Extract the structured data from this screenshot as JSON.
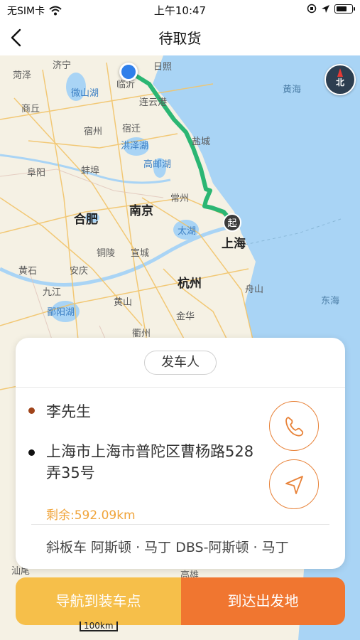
{
  "status_bar": {
    "carrier": "无SIM卡",
    "time": "上午10:47"
  },
  "nav": {
    "title": "待取货"
  },
  "map": {
    "labels": {
      "heze": "菏泽",
      "jining": "济宁",
      "rizhao": "日照",
      "weishan_lake": "微山湖",
      "linyi": "临沂",
      "lianyungang": "连云港",
      "shangqiu": "商丘",
      "suzhou_ah": "宿州",
      "suqian": "宿迁",
      "hongze_lake": "洪泽湖",
      "yancheng": "盐城",
      "gaoyou_lake": "高邮湖",
      "fuyang": "阜阳",
      "bengbu": "蚌埠",
      "changzhou": "常州",
      "nanjing": "南京",
      "hefei": "合肥",
      "taihu": "太湖",
      "shanghai": "上海",
      "tongling": "铜陵",
      "xuancheng": "宣城",
      "anqing": "安庆",
      "huangshi": "黄石",
      "hangzhou": "杭州",
      "jiujiang": "九江",
      "zhoushan": "舟山",
      "poyang_lake": "鄱阳湖",
      "huangshan": "黄山",
      "jinhua": "金华",
      "quzhou": "衢州",
      "huanghai": "黄海",
      "donghai": "东海",
      "gaoxiong": "高雄",
      "shanwei": "汕尾"
    },
    "compass_label": "北",
    "start_marker": "起",
    "scale_label": "100km"
  },
  "card": {
    "tag": "发车人",
    "contact_name": "李先生",
    "address": "上海市上海市普陀区曹杨路528弄35号",
    "remaining": "剩余:592.09km",
    "vehicle": "斜板车  阿斯顿 · 马丁 DBS-阿斯顿 · 马丁"
  },
  "actions": {
    "navigate_label": "导航到装车点",
    "arrive_label": "到达出发地"
  },
  "colors": {
    "accent_orange": "#f07630",
    "accent_yellow": "#f6bf4a",
    "route_green": "#2bb673",
    "location_blue": "#2f7fea"
  }
}
